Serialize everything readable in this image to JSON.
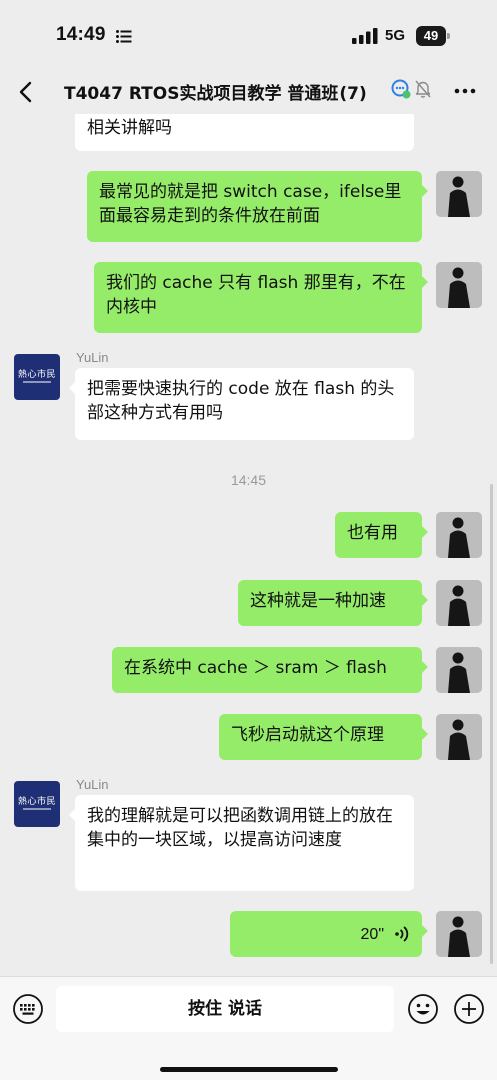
{
  "status_bar": {
    "time": "14:49",
    "network": "5G",
    "battery": "49"
  },
  "header": {
    "title": "T4047 RTOS实战项目教学 普通班",
    "member_count": "(7)"
  },
  "avatars": {
    "yulin_text": "熱心市民"
  },
  "messages": [
    {
      "side": "left",
      "text": "相关讲解吗"
    },
    {
      "side": "right",
      "text": "最常见的就是把 switch case，ifelse里面最容易走到的条件放在前面"
    },
    {
      "side": "right",
      "text": "我们的 cache 只有 flash 那里有，不在内核中"
    },
    {
      "side": "left",
      "sender": "YuLin",
      "text": "把需要快速执行的 code 放在 flash 的头部这种方式有用吗"
    },
    {
      "type": "time",
      "text": "14:45"
    },
    {
      "side": "right",
      "text": "也有用"
    },
    {
      "side": "right",
      "text": "这种就是一种加速"
    },
    {
      "side": "right",
      "text": "在系统中 cache ＞ sram ＞ flash"
    },
    {
      "side": "right",
      "text": "飞秒启动就这个原理"
    },
    {
      "side": "left",
      "sender": "YuLin",
      "text": "我的理解就是可以把函数调用链上的放在集中的一块区域，以提高访问速度"
    },
    {
      "side": "right",
      "type": "voice",
      "duration": "20\""
    }
  ],
  "input_bar": {
    "hold_to_talk": "按住 说话"
  },
  "colors": {
    "background": "#ededed",
    "bubble_self": "#95ec69",
    "bubble_other": "#ffffff",
    "avatar_yulin": "#1f2f75"
  }
}
